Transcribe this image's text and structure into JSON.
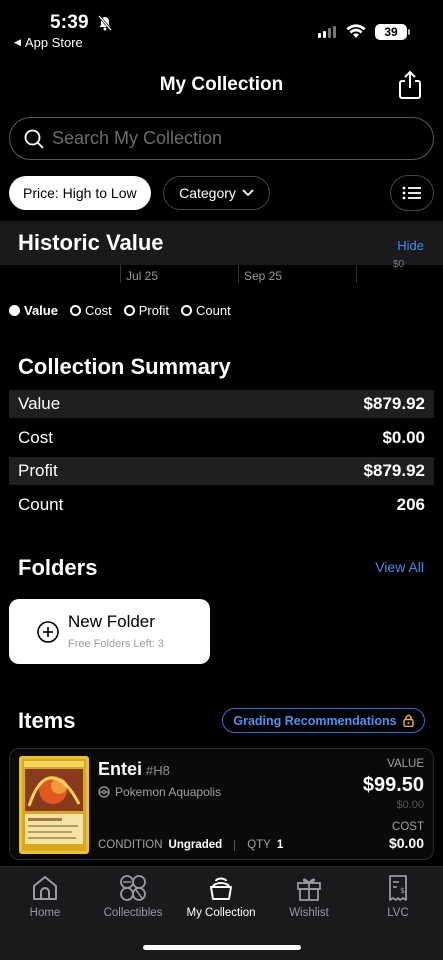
{
  "status_bar": {
    "time": "5:39",
    "back_label": "App Store",
    "battery": "39"
  },
  "header": {
    "title": "My Collection"
  },
  "search": {
    "placeholder": "Search My Collection",
    "value": ""
  },
  "filters": {
    "sort_label": "Price: High to Low",
    "category_label": "Category"
  },
  "historic_value": {
    "title": "Historic Value",
    "hide_label": "Hide",
    "axis_labels": [
      "Jul 25",
      "Sep 25"
    ],
    "y_label": "$0",
    "legend": [
      {
        "label": "Value",
        "active": true
      },
      {
        "label": "Cost",
        "active": false
      },
      {
        "label": "Profit",
        "active": false
      },
      {
        "label": "Count",
        "active": false
      }
    ]
  },
  "summary": {
    "title": "Collection Summary",
    "rows": [
      {
        "label": "Value",
        "value": "$879.92"
      },
      {
        "label": "Cost",
        "value": "$0.00"
      },
      {
        "label": "Profit",
        "value": "$879.92"
      },
      {
        "label": "Count",
        "value": "206"
      }
    ]
  },
  "folders": {
    "title": "Folders",
    "view_all": "View All",
    "new_folder_title": "New Folder",
    "new_folder_sub": "Free Folders Left: 3"
  },
  "items": {
    "title": "Items",
    "grading_button": "Grading Recommendations",
    "list": [
      {
        "name": "Entei",
        "number": "#H8",
        "set": "Pokemon Aquapolis",
        "condition_label": "CONDITION",
        "condition": "Ungraded",
        "qty_label": "QTY",
        "qty": "1",
        "value_label": "VALUE",
        "value": "$99.50",
        "value_sub": "$0.00",
        "cost_label": "COST",
        "cost": "$0.00"
      }
    ]
  },
  "tab_bar": {
    "tabs": [
      {
        "label": "Home",
        "icon": "home-icon",
        "active": false
      },
      {
        "label": "Collectibles",
        "icon": "collectibles-icon",
        "active": false
      },
      {
        "label": "My Collection",
        "icon": "collection-icon",
        "active": true
      },
      {
        "label": "Wishlist",
        "icon": "gift-icon",
        "active": false
      },
      {
        "label": "LVC",
        "icon": "receipt-icon",
        "active": false
      }
    ]
  },
  "colors": {
    "accent": "#3e8ef0",
    "background": "#000000",
    "card_bg": "#1f1f21"
  }
}
